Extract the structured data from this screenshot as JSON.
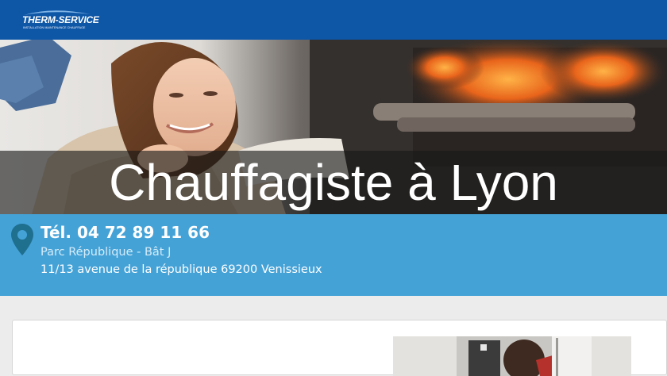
{
  "brand": {
    "name": "THERM-SERVICE",
    "tagline": "INSTALLATION MAINTENANCE CHAUFFAGE"
  },
  "hero": {
    "title": "Chauffagiste à Lyon"
  },
  "contact": {
    "phone": "Tél. 04 72 89 11 66",
    "address_line1": "Parc République - Bât J",
    "address_line2": "11/13 avenue de la république 69200 Venissieux"
  },
  "colors": {
    "topbar": "#0e56a6",
    "contact_bg": "#45a2d7",
    "pin": "#1f6f8f"
  }
}
